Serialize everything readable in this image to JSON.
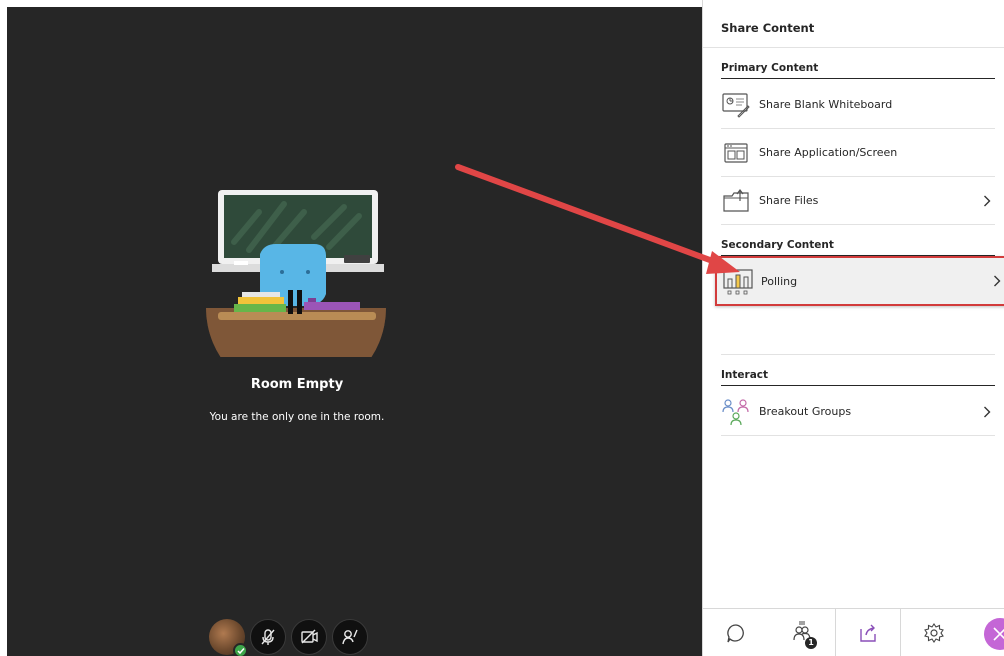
{
  "stage": {
    "room_title": "Room Empty",
    "room_subtitle": "You are the only one in the room.",
    "media_controls": {
      "avatar_icon": "user-avatar",
      "mic_icon": "microphone-off-icon",
      "camera_icon": "camera-off-icon",
      "hand_icon": "raise-hand-icon"
    }
  },
  "panel": {
    "title": "Share Content",
    "sections": {
      "primary": {
        "heading": "Primary Content",
        "items": [
          {
            "label": "Share Blank Whiteboard",
            "icon": "whiteboard-icon"
          },
          {
            "label": "Share Application/Screen",
            "icon": "screen-share-icon"
          },
          {
            "label": "Share Files",
            "icon": "folder-icon"
          }
        ]
      },
      "secondary": {
        "heading": "Secondary Content",
        "items": [
          {
            "label": "Polling",
            "icon": "polling-icon"
          }
        ]
      },
      "interact": {
        "heading": "Interact",
        "items": [
          {
            "label": "Breakout Groups",
            "icon": "breakout-groups-icon"
          }
        ]
      }
    },
    "bottom_bar": {
      "attendee_count": "1",
      "tabs": [
        "chat-icon",
        "attendees-icon",
        "share-content-icon",
        "settings-icon",
        "close-icon"
      ]
    }
  },
  "colors": {
    "stage_bg": "#262626",
    "highlight_border": "#d23b3b",
    "arrow": "#e04646",
    "close_button": "#c466d6",
    "share_tab_accent": "#8a4fb8"
  }
}
